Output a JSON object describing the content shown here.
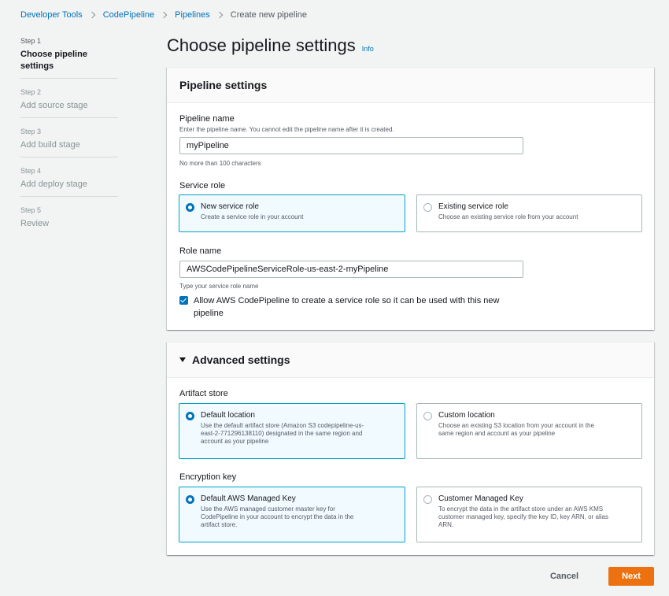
{
  "breadcrumb": {
    "items": [
      "Developer Tools",
      "CodePipeline",
      "Pipelines"
    ],
    "current": "Create new pipeline"
  },
  "steps": [
    {
      "num": "Step 1",
      "title": "Choose pipeline settings",
      "active": true
    },
    {
      "num": "Step 2",
      "title": "Add source stage",
      "active": false
    },
    {
      "num": "Step 3",
      "title": "Add build stage",
      "active": false
    },
    {
      "num": "Step 4",
      "title": "Add deploy stage",
      "active": false
    },
    {
      "num": "Step 5",
      "title": "Review",
      "active": false
    }
  ],
  "page": {
    "title": "Choose pipeline settings",
    "info": "Info"
  },
  "pipeline_settings": {
    "header": "Pipeline settings",
    "name_label": "Pipeline name",
    "name_desc": "Enter the pipeline name. You cannot edit the pipeline name after it is created.",
    "name_value": "myPipeline",
    "name_hint": "No more than 100 characters",
    "service_role_label": "Service role",
    "new_role": {
      "title": "New service role",
      "desc": "Create a service role in your account",
      "selected": true
    },
    "existing_role": {
      "title": "Existing service role",
      "desc": "Choose an existing service role from your account",
      "selected": false
    },
    "role_name_label": "Role name",
    "role_name_value": "AWSCodePipelineServiceRole-us-east-2-myPipeline",
    "role_name_hint": "Type your service role name",
    "allow_checkbox": {
      "checked": true,
      "line1": "Allow AWS CodePipeline to create a service role so it can be used with this new",
      "line2": "pipeline"
    }
  },
  "advanced_settings": {
    "header": "Advanced settings",
    "artifact_store_label": "Artifact store",
    "default_location": {
      "title": "Default location",
      "desc1": "Use the default artifact store (Amazon S3 codepipeline-us-",
      "desc2": "east-2-771296138110) designated in the same region and",
      "desc3": "account as your pipeline",
      "selected": true
    },
    "custom_location": {
      "title": "Custom location",
      "desc1": "Choose an existing S3 location from your account in the",
      "desc2": "same region and account as your pipeline",
      "selected": false
    },
    "encryption_key_label": "Encryption key",
    "default_key": {
      "title": "Default AWS Managed Key",
      "desc1": "Use the AWS managed customer master key for",
      "desc2": "CodePipeline in your account to encrypt the data in the",
      "desc3": "artifact store.",
      "selected": true
    },
    "customer_key": {
      "title": "Customer Managed Key",
      "desc1": "To encrypt the data in the artifact store under an AWS KMS",
      "desc2": "customer managed key, specify the key ID, key ARN, or alias",
      "desc3": "ARN.",
      "selected": false
    }
  },
  "actions": {
    "cancel": "Cancel",
    "next": "Next"
  },
  "colors": {
    "link": "#0073bb",
    "primary_button": "#ec7211",
    "selected_tile_bg": "#f1faff",
    "selected_tile_border": "#00a1c9"
  }
}
